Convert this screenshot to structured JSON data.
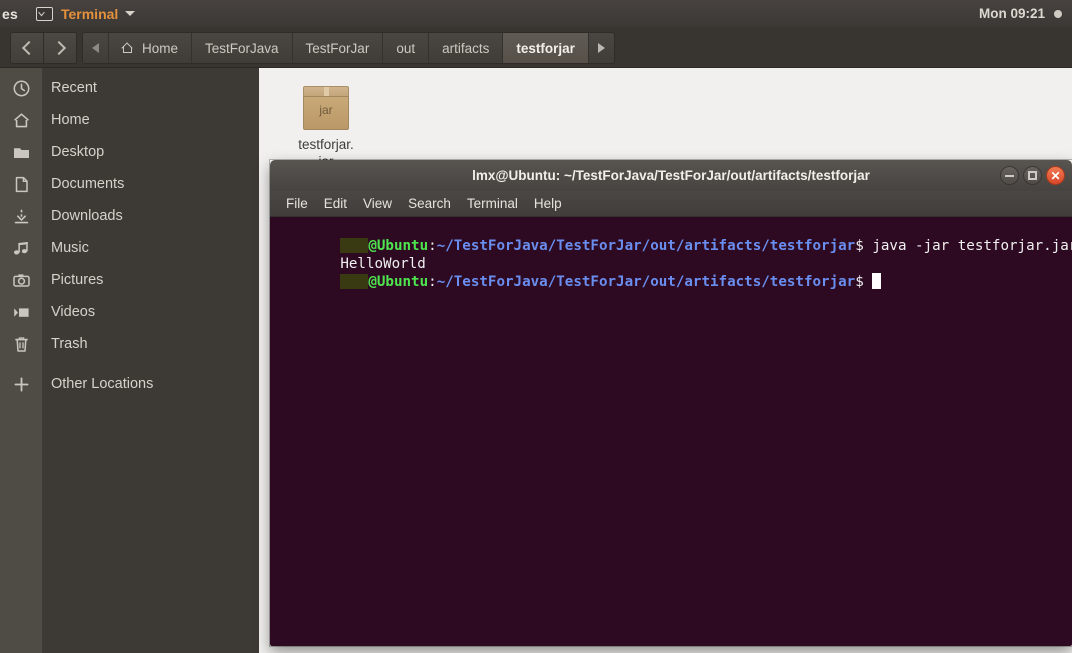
{
  "top_panel": {
    "app_menu_truncated": "es",
    "terminal_icon": "terminal-icon",
    "app_menu_label": "Terminal",
    "clock": "Mon 09:21"
  },
  "files_window": {
    "nav": {
      "back_label": "Back",
      "forward_label": "Forward"
    },
    "breadcrumbs": [
      {
        "label": "Home",
        "icon": "home-icon",
        "active": false
      },
      {
        "label": "TestForJava",
        "active": false
      },
      {
        "label": "TestForJar",
        "active": false
      },
      {
        "label": "out",
        "active": false
      },
      {
        "label": "artifacts",
        "active": false
      },
      {
        "label": "testforjar",
        "active": true
      }
    ],
    "sidebar": {
      "items": [
        {
          "label": "Recent",
          "icon": "clock-icon"
        },
        {
          "label": "Home",
          "icon": "home-icon"
        },
        {
          "label": "Desktop",
          "icon": "folder-icon"
        },
        {
          "label": "Documents",
          "icon": "document-icon"
        },
        {
          "label": "Downloads",
          "icon": "download-icon"
        },
        {
          "label": "Music",
          "icon": "music-note-icon"
        },
        {
          "label": "Pictures",
          "icon": "camera-icon"
        },
        {
          "label": "Videos",
          "icon": "video-icon"
        },
        {
          "label": "Trash",
          "icon": "trash-icon"
        },
        {
          "label": "Other Locations",
          "icon": "plus-icon"
        }
      ]
    },
    "files": [
      {
        "name_line_1": "testforjar.",
        "name_line_2": "jar",
        "icon": "jar-archive-icon",
        "icon_text": "jar"
      }
    ]
  },
  "terminal": {
    "title": "lmx@Ubuntu: ~/TestForJava/TestForJar/out/artifacts/testforjar",
    "menus": [
      "File",
      "Edit",
      "View",
      "Search",
      "Terminal",
      "Help"
    ],
    "window_controls": {
      "minimize": "minimize-button",
      "maximize": "maximize-button",
      "close": "close-button"
    },
    "lines": [
      {
        "type": "prompt",
        "user_redacted": true,
        "host": "@Ubuntu",
        "separator": ":",
        "path": "~/TestForJava/TestForJar/out/artifacts/testforjar",
        "sigil": "$",
        "command": " java -jar testforjar.jar"
      },
      {
        "type": "output",
        "text": "HelloWorld"
      },
      {
        "type": "prompt",
        "user_redacted": true,
        "host": "@Ubuntu",
        "separator": ":",
        "path": "~/TestForJava/TestForJar/out/artifacts/testforjar",
        "sigil": "$",
        "command": " ",
        "cursor": true
      }
    ]
  },
  "colors": {
    "panel_bg": "#3c3835",
    "accent_orange": "#e4913c",
    "toolbar_bg": "#383531",
    "sidebar_bg": "#3d3a36",
    "sidebar_rail_bg": "#4f4c46",
    "fileview_bg": "#f1f0ee",
    "terminal_bg": "#2d0a22",
    "prompt_green": "#4ee44e",
    "prompt_blue": "#6a8ef0",
    "close_button": "#d9472a"
  }
}
